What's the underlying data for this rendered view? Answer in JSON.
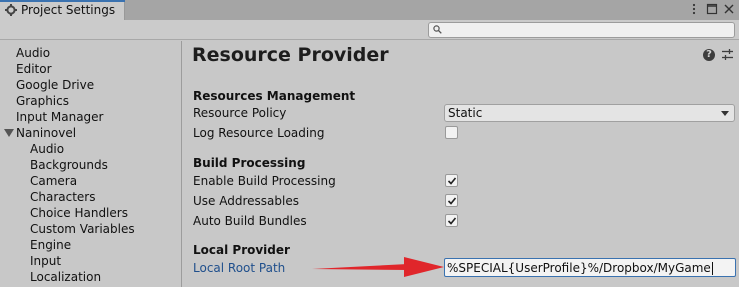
{
  "window": {
    "tab_title": "Project Settings"
  },
  "search": {
    "placeholder": ""
  },
  "sidebar": {
    "items": [
      {
        "label": "Audio"
      },
      {
        "label": "Editor"
      },
      {
        "label": "Google Drive"
      },
      {
        "label": "Graphics"
      },
      {
        "label": "Input Manager"
      },
      {
        "label": "Naninovel"
      }
    ],
    "children": [
      {
        "label": "Audio"
      },
      {
        "label": "Backgrounds"
      },
      {
        "label": "Camera"
      },
      {
        "label": "Characters"
      },
      {
        "label": "Choice Handlers"
      },
      {
        "label": "Custom Variables"
      },
      {
        "label": "Engine"
      },
      {
        "label": "Input"
      },
      {
        "label": "Localization"
      }
    ]
  },
  "main": {
    "title": "Resource Provider",
    "help_icon": "?",
    "sections": {
      "resources": {
        "header": "Resources Management",
        "resource_policy_label": "Resource Policy",
        "resource_policy_value": "Static",
        "log_loading_label": "Log Resource Loading",
        "log_loading_checked": false
      },
      "build": {
        "header": "Build Processing",
        "enable_label": "Enable Build Processing",
        "enable_checked": true,
        "addressables_label": "Use Addressables",
        "addressables_checked": true,
        "auto_bundles_label": "Auto Build Bundles",
        "auto_bundles_checked": true
      },
      "local": {
        "header": "Local Provider",
        "root_path_label": "Local Root Path",
        "root_path_value": "%SPECIAL{UserProfile}%/Dropbox/MyGame"
      }
    }
  },
  "colors": {
    "accent": "#3a72b0",
    "annotation_arrow": "#e0262b",
    "link_label": "#1f4f8c"
  },
  "icons": {
    "tab": "gear-icon",
    "menu": "kebab-menu-icon",
    "maximize": "maximize-icon",
    "close": "close-icon",
    "search": "search-icon",
    "help": "help-icon",
    "presets": "presets-icon"
  }
}
